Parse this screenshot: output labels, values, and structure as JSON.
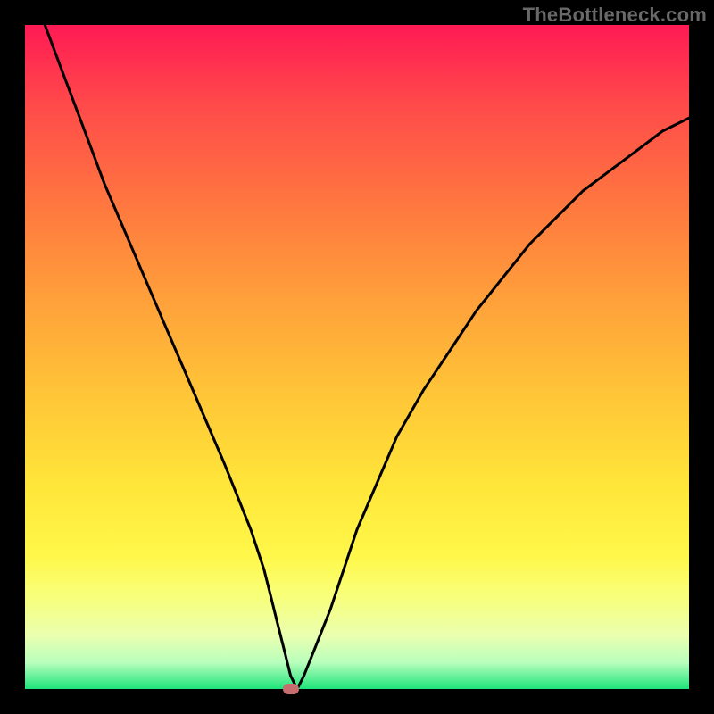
{
  "watermark": "TheBottleneck.com",
  "chart_data": {
    "type": "line",
    "title": "",
    "xlabel": "",
    "ylabel": "",
    "xlim": [
      0,
      100
    ],
    "ylim": [
      0,
      100
    ],
    "grid": false,
    "legend": false,
    "series": [
      {
        "name": "bottleneck-curve",
        "x": [
          0,
          3,
          6,
          9,
          12,
          15,
          18,
          21,
          24,
          27,
          30,
          32,
          34,
          36,
          37,
          38,
          39,
          40,
          41,
          42,
          44,
          46,
          48,
          50,
          53,
          56,
          60,
          64,
          68,
          72,
          76,
          80,
          84,
          88,
          92,
          96,
          100
        ],
        "values": [
          110,
          100,
          92,
          84,
          76,
          69,
          62,
          55,
          48,
          41,
          34,
          29,
          24,
          18,
          14,
          10,
          6,
          2,
          0,
          2,
          7,
          12,
          18,
          24,
          31,
          38,
          45,
          51,
          57,
          62,
          67,
          71,
          75,
          78,
          81,
          84,
          86
        ]
      }
    ],
    "marker": {
      "x": 40,
      "y": 0
    },
    "colors": {
      "top": "#ff1a54",
      "mid": "#ffe73a",
      "bottom": "#1ee47a",
      "curve": "#000000",
      "marker": "#c86d6d"
    }
  }
}
